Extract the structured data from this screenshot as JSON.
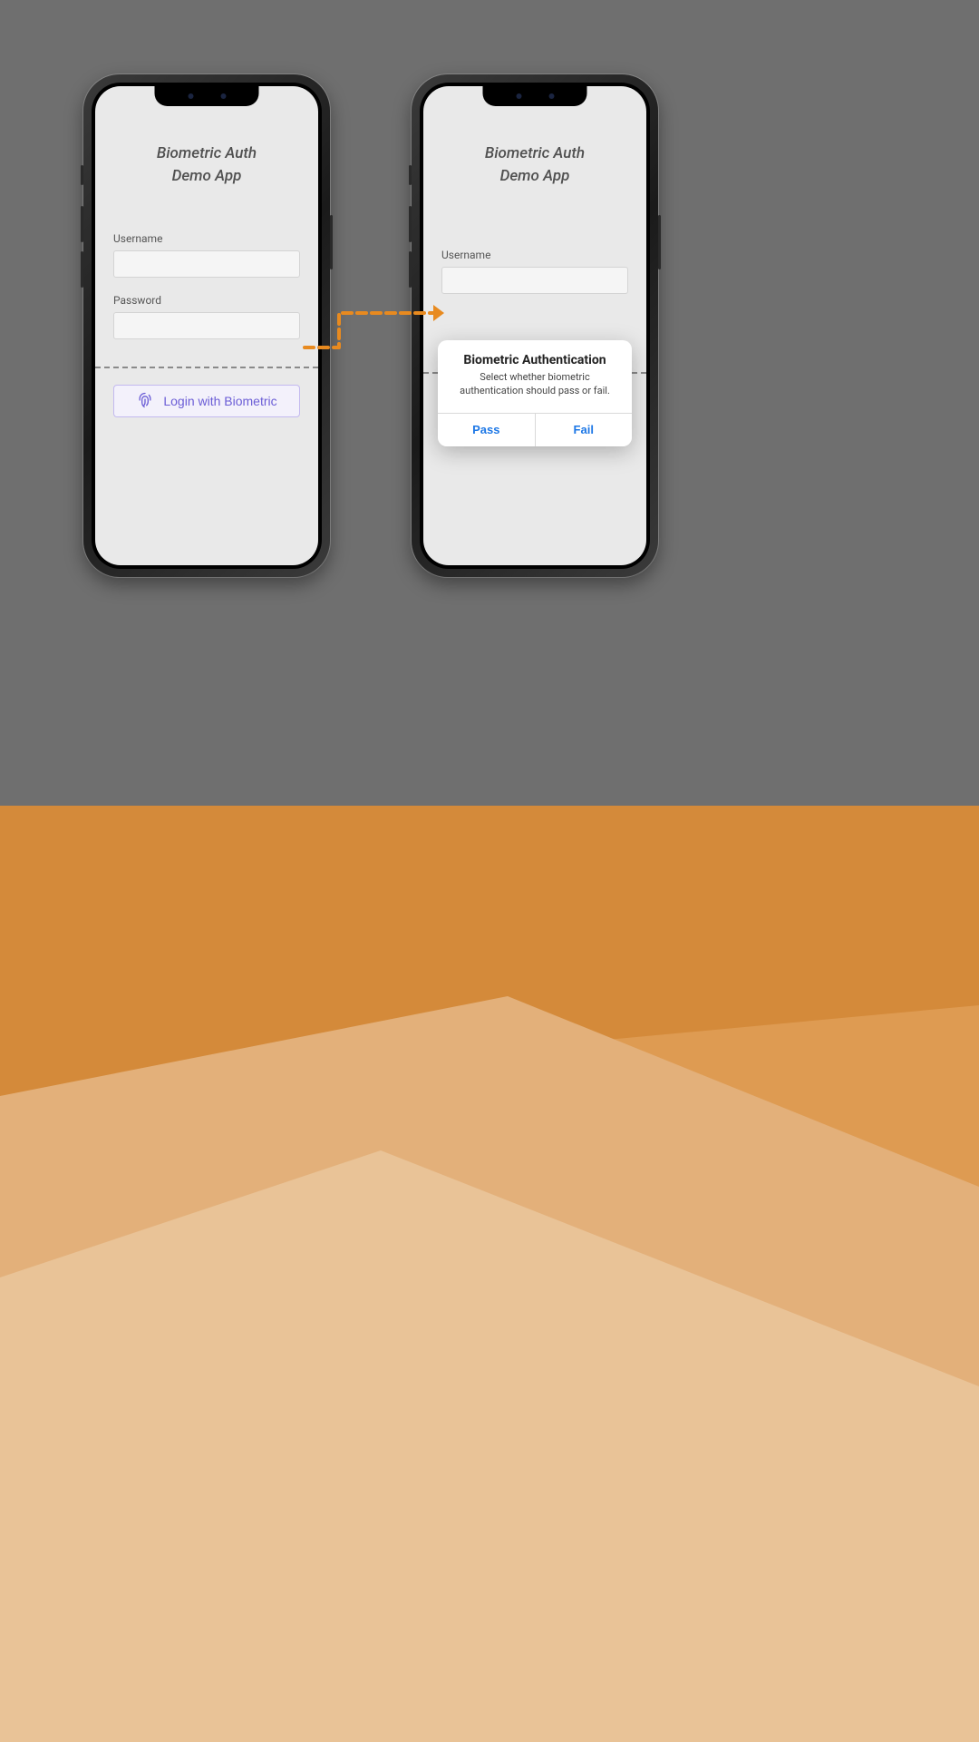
{
  "app": {
    "title_line1": "Biometric Auth",
    "title_line2": "Demo App"
  },
  "form": {
    "username_label": "Username",
    "username_value": "",
    "password_label": "Password",
    "password_value": ""
  },
  "biometric_button": {
    "label": "Login with Biometric",
    "icon": "fingerprint-icon"
  },
  "dialog": {
    "title": "Biometric Authentication",
    "subtitle": "Select whether biometric authentication should pass or fail.",
    "pass_label": "Pass",
    "fail_label": "Fail"
  },
  "colors": {
    "accent_purple": "#6b5dd6",
    "dialog_action_blue": "#1e78e6",
    "arrow_orange": "#e88a1f"
  }
}
